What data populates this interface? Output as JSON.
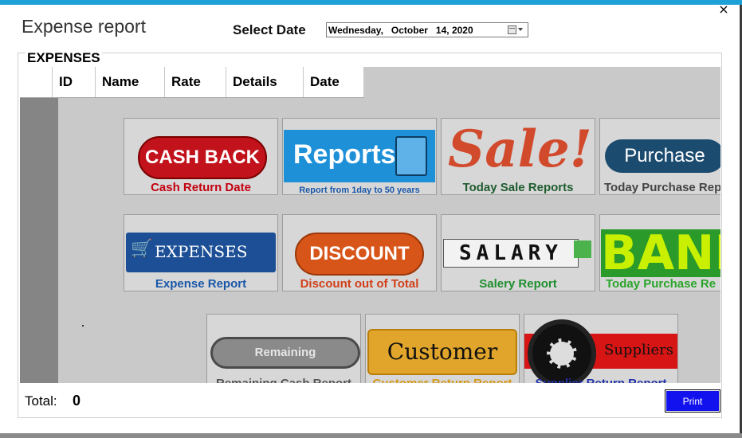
{
  "window": {
    "title": "Expense report",
    "close_glyph": "×"
  },
  "date_picker": {
    "label": "Select Date",
    "value": "Wednesday,   October   14, 2020"
  },
  "group": {
    "label": "EXPENSES"
  },
  "table": {
    "columns": [
      "ID",
      "Name",
      "Rate",
      "Details",
      "Date"
    ]
  },
  "tiles": [
    {
      "image_text": "CASH BACK",
      "caption": "Cash Return Date",
      "caption_color": "#c40010"
    },
    {
      "image_text": "Reports",
      "caption": "Report from 1day to 50 years",
      "caption_color": "#1a57a8"
    },
    {
      "image_text": "Sale!",
      "caption": "Today Sale Reports",
      "caption_color": "#1f5c2e"
    },
    {
      "image_text": "Purchase",
      "caption": "Today Purchase Rep",
      "caption_color": "#444444"
    },
    {
      "image_text": "EXPENSES",
      "caption": "Expense Report",
      "caption_color": "#1a57a8"
    },
    {
      "image_text": "DISCOUNT",
      "caption": "Discount out of Total",
      "caption_color": "#d2401a"
    },
    {
      "image_text": "SALARY",
      "caption": "Salery Report",
      "caption_color": "#1f8f2e"
    },
    {
      "image_text": "BANK",
      "caption": "Today Purchase Re",
      "caption_color": "#2aa52a"
    },
    {
      "image_text": "Remaining",
      "caption": "Remaining Cash Report",
      "caption_color": "#555555"
    },
    {
      "image_text": "Customer",
      "caption": "Customer Return Report",
      "caption_color": "#d49a1a"
    },
    {
      "image_text": "Suppliers",
      "caption": "Supplier Return Report",
      "caption_color": "#2233aa"
    }
  ],
  "footer": {
    "total_label": "Total:",
    "total_value": "0",
    "print_label": "Print"
  },
  "colors": {
    "title_bar_accent": "#1ea1d6",
    "print_button": "#1212ee",
    "grid_background": "#c9c9c9"
  }
}
